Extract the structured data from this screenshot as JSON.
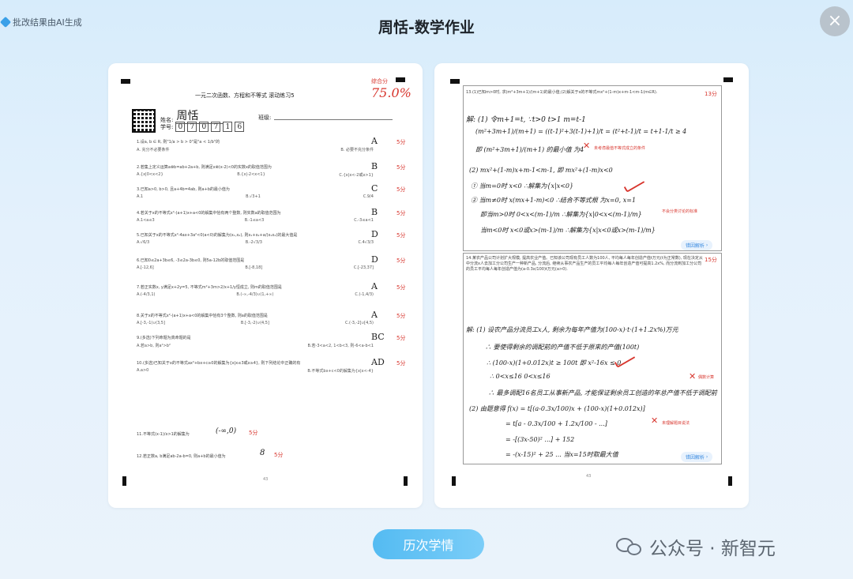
{
  "header": {
    "ai_notice": "批改结果由AI生成",
    "title": "周恬-数学作业",
    "close_symbol": "×"
  },
  "page1": {
    "score_label": "综合分",
    "score": "75.0%",
    "sheet_title": "一元二次函数、方程和不等式 滚动练习5",
    "name_label": "姓名:",
    "name": "周恬",
    "class_label": "班级:",
    "id_label": "学号:",
    "id_digits": [
      "0",
      "7",
      "0",
      "7",
      "1",
      "6"
    ],
    "questions": [
      {
        "text": "1.设a, b ∈ R, 则\"1/a > b > 0\"是\"a < 1/b\"的",
        "opts": [
          "A. 充分不必要条件",
          "B. 必要不充分条件"
        ],
        "answer": "A",
        "points": "5分"
      },
      {
        "text": "2.若集上定义运算a⊗b=ab+2a+b, 则满足x⊗(x-2)<0的实数x的取值范围为",
        "opts": [
          "A.{x|0<x<2}",
          "B.{x|-2<x<1}",
          "C.{x|x<-2或x>1}"
        ],
        "answer": "B",
        "points": "5分"
      },
      {
        "text": "3.已知a>0, b>0, 且a+4b=4ab, 则a+b的最小值为",
        "opts": [
          "A.1",
          "B.√3+1",
          "C.9/4"
        ],
        "answer": "C",
        "points": "5分"
      },
      {
        "text": "4.若关于x的不等式x²-(a+1)x+a<0的解集中恰有两个整数, 则实数a的取值范围为",
        "opts": [
          "A.1<a≤3",
          "B.-1≤a<3",
          "C.-3≤a<1"
        ],
        "answer": "B",
        "points": "5分"
      },
      {
        "text": "5.已知关于x的不等式x²-4ax+3a²<0(a<0)的解集为(x₁,x₂), 则x₁+x₂+a/(x₁x₂)的最大值是",
        "opts": [
          "A.√6/3",
          "B.-2√3/3",
          "C.4√3/3"
        ],
        "answer": "D",
        "points": "5分"
      },
      {
        "text": "6.已知0≤2a+3b≤6, -3≤2a-3b≤0, 则5a-12b的取值范围是",
        "opts": [
          "A.[-12,6]",
          "B.[-8,18]",
          "C.[-23,37]"
        ],
        "answer": "D",
        "points": "5分"
      },
      {
        "text": "7.若正实数x, y满足x+2y=5, 不等式m²+3m>2/x+1/y恒成立, 则m的取值范围是",
        "opts": [
          "A.(-4/3,1)",
          "B.(-∞,-4/3)∪(1,+∞)",
          "C.(-1,4/3)"
        ],
        "answer": "A",
        "points": "5分"
      },
      {
        "text": "8.关于x的不等式x²-(a+1)x+a<0的解集中恰有3个整数, 则a的取值范围是",
        "opts": [
          "A.[-3,-1)∪(3,5]",
          "B.[-3,-2)∪(4,5]",
          "C.(-3,-2]∪[4,5)"
        ],
        "answer": "A",
        "points": "5分"
      },
      {
        "text": "9.(多选)下列命题为真命题的是",
        "opts": [
          "A.若a>b, 则a²>b²",
          "B.若-3<a<2, 1<b<3, 则-6<a-b<1"
        ],
        "answer": "BC",
        "points": "5分"
      },
      {
        "text": "10.(多选)已知关于x的不等式ax²+bx+c≥0的解集为{x|x≤3或x≥4}, 则下列结论中正确的有",
        "opts": [
          "A.a>0",
          "B.不等式bx+c<0的解集为{x|x<-4}"
        ],
        "answer": "AD",
        "points": "5分"
      }
    ],
    "fill_blanks": [
      {
        "text": "11.不等式(x-1)/x>1的解集为",
        "answer": "(-∞,0)",
        "points": "5分"
      },
      {
        "text": "12.若正数a, b满足ab-2a-b=0, 则a+b的最小值为",
        "answer": "8",
        "points": "5分"
      }
    ],
    "page_number": "43"
  },
  "page2": {
    "q13_points": "13分",
    "q13_text": "13.(1)已知m>0时, 求(m²+3m+1)/(m+1)的最小值;(2)解关于x的不等式mx²+(1-m)x+m-1<m-1(m∈R).",
    "q13_lines": [
      "解: (1) 令m+1=t,  ∵t>0  t>1  m=t-1",
      "(m²+3m+1)/(m+1) = ((t-1)²+3(t-1)+1)/t = (t²+t-1)/t = t+1-1/t ≥ 4",
      "即 (m²+3m+1)/(m+1) 的最小值 为4",
      "(2) mx²+(1-m)x+m-1<m-1, 即 mx²+(1-m)x<0",
      "① 当m=0时  x<0     ∴解集为{x|x<0}",
      "② 当m≠0时  x(mx+1-m)<0  ∴结合不等式根 为x=0, x=1",
      "即当m>0时  0<x<(m-1)/m   ∴解集为{x|0<x<(m-1)/m}",
      "当m<0时  x<0或x>(m-1)/m   ∴解集为{x|x<0或x>(m-1)/m}"
    ],
    "q13_notes": [
      "未考虑最值不等式成立的条件",
      "不会分类讨论的标准"
    ],
    "q14_points": "15分",
    "q14_text": "14.某农产品公司计划扩大规模, 提高农业产值。已知该公司现有员工人数为100人, 平均每人每年创造产值t万元(t为正常数), 现在决定从中分流x人去加工分公司生产一种新产品, 分流后, 继续从事农产品生产的员工平均每人每年创造产值可提高1.2x%, 而分流到加工分公司的员工平均每人每年创造产值为(a-0.3x/100)t万元(a>0).",
    "q14_lines": [
      "解: (1) 设农产品分流员工x人, 剩余为每年产值为(100-x)·t·(1+1.2x%)万元",
      "∴ 要使得剩余的调配前的产值不低于原来的产值(100t)",
      "∴ (100-x)(1+0.012x)t ≥ 100t   即 x²-16x ≤ 0",
      "∴ 0<x≤16    0<x≤16",
      "∴ 最多调配16名员工从事新产品, 才能保证剩余员工创造的年总产值不低于调配前",
      "(2) 由题意得 f(x) = t[(a-0.3x/100)x + (100-x)(1+0.012x)]",
      "= t[a - 0.3x/100 + 1.2x/100 - ...]",
      "= -[(3x-50)² ...] + 152",
      "= -(x-15)² + 25 ... 当x=15时取最大值"
    ],
    "q14_notes": [
      "偶数计算",
      "未理解题目说法"
    ],
    "analysis_label": "错因解析",
    "page_number": "43"
  },
  "footer": {
    "history_button": "历次学情",
    "watermark": "公众号 · 新智元"
  },
  "colors": {
    "accent": "#54bbf2",
    "grading_red": "#d8372f",
    "background": "#dcedfb"
  }
}
